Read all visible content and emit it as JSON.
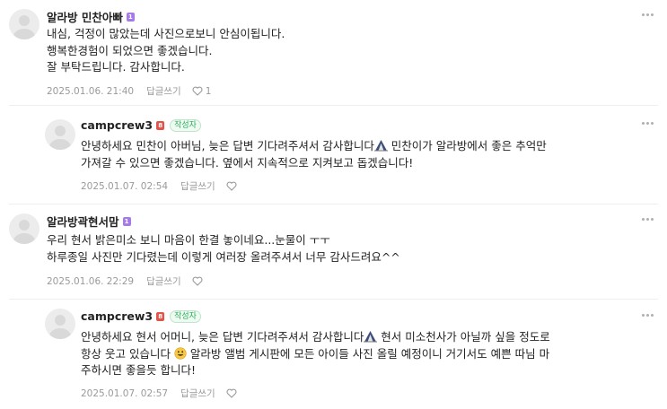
{
  "comments": [
    {
      "author": "알라방 민찬아빠",
      "level": "1",
      "is_writer": false,
      "lines": [
        "내심, 걱정이 많았는데 사진으로보니 안심이됩니다.",
        "행복한경험이 되었으면 좋겠습니다.",
        "잘 부탁드립니다. 감사합니다."
      ],
      "date": "2025.01.06. 21:40",
      "reply_label": "답글쓰기",
      "like_count": "1"
    },
    {
      "author": "campcrew3",
      "level": "8",
      "is_writer": true,
      "writer_label": "작성자",
      "line1_a": "안녕하세요 민찬이 아버님, 늦은 답변 기다려주셔서 감사합니다",
      "line1_b": " 민찬이가 알라방에서 좋은 추억만",
      "line2": "가져갈 수 있으면 좋겠습니다. 옆에서 지속적으로 지켜보고 돕겠습니다!",
      "date": "2025.01.07. 02:54",
      "reply_label": "답글쓰기",
      "like_count": ""
    },
    {
      "author": "알라방곽현서맘",
      "level": "1",
      "is_writer": false,
      "lines": [
        "우리 현서 밝은미소 보니 마음이 한결 놓이네요...눈물이 ㅜㅜ",
        "하루종일 사진만 기다렸는데 이렇게 여러장 올려주셔서 너무 감사드려요^^"
      ],
      "date": "2025.01.06. 22:29",
      "reply_label": "답글쓰기",
      "like_count": ""
    },
    {
      "author": "campcrew3",
      "level": "8",
      "is_writer": true,
      "writer_label": "작성자",
      "line1_a": "안녕하세요 현서 어머니, 늦은 답변 기다려주셔서 감사합니다",
      "line1_b": " 현서 미소천사가 아닐까 싶을 정도로",
      "line2_a": "항상 웃고 있습니다 ",
      "line2_b": " 알라방 앨범 게시판에 모든 아이들 사진 올릴 예정이니 거기서도 예쁜 따님 마",
      "line3": "주하시면 좋을듯 합니다!",
      "date": "2025.01.07. 02:57",
      "reply_label": "답글쓰기",
      "like_count": ""
    }
  ],
  "icons": {
    "more": "more-dots-icon",
    "like": "heart-outline-icon",
    "avatar": "default-profile-icon",
    "emoji_camp": "camping-tent-emoji",
    "emoji_smile": "grinning-face-emoji"
  },
  "colors": {
    "writer_tag": "#2fae5a",
    "level_purple": "#a77be7",
    "level_red": "#e2544a",
    "meta": "#9a9a9a"
  }
}
